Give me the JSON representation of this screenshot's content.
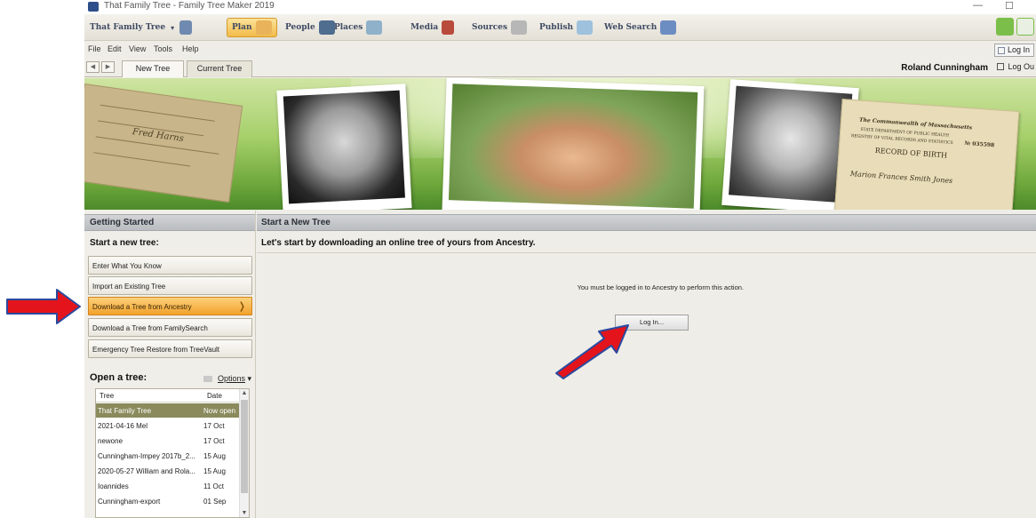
{
  "window": {
    "title": "That Family Tree - Family Tree Maker 2019"
  },
  "toolbar": {
    "tree_name": "That Family Tree",
    "items": [
      {
        "label": "Plan",
        "icon": "plan-icon"
      },
      {
        "label": "People",
        "icon": "people-icon"
      },
      {
        "label": "Places",
        "icon": "places-icon"
      },
      {
        "label": "Media",
        "icon": "media-icon"
      },
      {
        "label": "Sources",
        "icon": "sources-icon"
      },
      {
        "label": "Publish",
        "icon": "publish-icon"
      },
      {
        "label": "Web Search",
        "icon": "web-search-icon"
      }
    ]
  },
  "menu": {
    "file": "File",
    "edit": "Edit",
    "view": "View",
    "tools": "Tools",
    "help": "Help"
  },
  "tabs": {
    "new_tree": "New Tree",
    "current_tree": "Current Tree"
  },
  "account": {
    "login": "Log In",
    "user": "Roland Cunningham",
    "logout": "Log Ou"
  },
  "banner": {
    "cert_line1": "The Commonwealth of Massachusetts",
    "cert_line2": "STATE DEPARTMENT OF PUBLIC HEALTH",
    "cert_line3": "REGISTRY OF VITAL RECORDS AND STATISTICS",
    "cert_number": "№ 035598",
    "cert_title": "RECORD OF BIRTH",
    "cert_name": "Marion Frances Smith Jones",
    "doc_script": "Fred Harns"
  },
  "getting_started": {
    "header": "Getting Started",
    "start_title": "Start a new tree:",
    "buttons": [
      "Enter What You Know",
      "Import an Existing Tree",
      "Download a Tree from Ancestry",
      "Download a Tree from FamilySearch",
      "Emergency Tree Restore from TreeVault"
    ],
    "open_title": "Open a tree:",
    "options": "Options",
    "list_headers": {
      "tree": "Tree",
      "date": "Date"
    },
    "trees": [
      {
        "name": "That Family Tree",
        "date": "Now open"
      },
      {
        "name": "2021-04-16 Mel",
        "date": "17 Oct"
      },
      {
        "name": "newone",
        "date": "17 Oct"
      },
      {
        "name": "Cunningham-Impey 2017b_2...",
        "date": "15 Aug"
      },
      {
        "name": "2020-05-27 William and Rola...",
        "date": "15 Aug"
      },
      {
        "name": "Ioannides",
        "date": "11 Oct"
      },
      {
        "name": "Cunningham-export",
        "date": "01 Sep"
      }
    ]
  },
  "main": {
    "header": "Start a New Tree",
    "subtitle": "Let's start by downloading an online tree of yours from Ancestry.",
    "message": "You must be logged in to Ancestry to perform this action.",
    "login_button": "Log In..."
  },
  "colors": {
    "arrow": "#e3141b",
    "arrow_outline": "#2a4aa0",
    "active_button": "#f2a12c",
    "selected_row": "#8a8a5c"
  }
}
